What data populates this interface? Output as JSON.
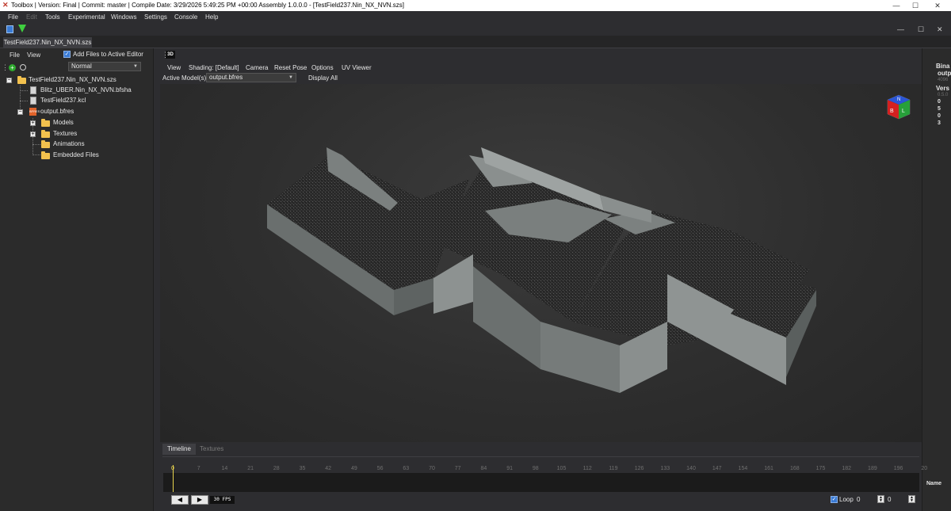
{
  "window": {
    "title": "Toolbox | Version: Final | Commit: master | Compile Date: 3/29/2026 5:49:25 PM +00:00 Assembly 1.0.0.0 - [TestField237.Nin_NX_NVN.szs]"
  },
  "menubar": {
    "items": [
      "File",
      "Edit",
      "Tools",
      "Experimental",
      "Windows",
      "Settings",
      "Console",
      "Help"
    ]
  },
  "doc_tab": {
    "label": "TestField237.Nin_NX_NVN.szs"
  },
  "left_panel": {
    "menu": [
      "File",
      "View"
    ],
    "add_files_label": "Add Files to Active Editor",
    "mode_value": "Normal",
    "tree": [
      {
        "label": "TestField237.Nin_NX_NVN.szs"
      },
      {
        "label": "Blitz_UBER.Nin_NX_NVN.bfsha"
      },
      {
        "label": "TestField237.kcl"
      },
      {
        "label": "output.bfres"
      },
      {
        "label": "Models"
      },
      {
        "label": "Textures"
      },
      {
        "label": "Animations"
      },
      {
        "label": "Embedded Files"
      }
    ]
  },
  "viewport": {
    "badge": "3D",
    "menu": [
      "View",
      "Shading: [Default]",
      "Camera",
      "Reset Pose",
      "Options",
      "UV Viewer"
    ],
    "active_models_label": "Active Model(s):",
    "active_model_value": "output.bfres",
    "display_all_label": "Display All",
    "gizmo_letters": [
      "N",
      "B",
      "L"
    ]
  },
  "right_panel": {
    "lines": [
      "Bina",
      "outp",
      "4096",
      "Vers",
      "0.5.0",
      "0",
      "5",
      "0",
      "3"
    ],
    "name_label": "Name"
  },
  "timeline": {
    "tabs": [
      "Timeline",
      "Textures"
    ],
    "ticks": [
      "0",
      "7",
      "14",
      "21",
      "28",
      "35",
      "42",
      "49",
      "56",
      "63",
      "70",
      "77",
      "84",
      "91",
      "98",
      "105",
      "112",
      "119",
      "126",
      "133",
      "140",
      "147",
      "154",
      "161",
      "168",
      "175",
      "182",
      "189",
      "196",
      "20"
    ],
    "fps_label": "30 FPS",
    "loop_label": "Loop",
    "loop_value": "0",
    "frame_value": "0"
  },
  "colors": {
    "accent": "#3a7bd5",
    "background": "#2d2d30",
    "folder": "#f2c14e",
    "bfres": "#e0632a",
    "playhead": "#e8d44d"
  }
}
